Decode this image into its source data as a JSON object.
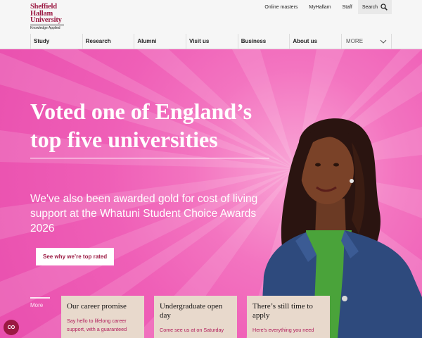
{
  "brand": {
    "line1": "Sheffield",
    "line2": "Hallam",
    "line3": "University",
    "tagline": "Knowledge Applied",
    "color": "#9b1942"
  },
  "utility": {
    "links": [
      "Online masters",
      "MyHallam",
      "Staff"
    ],
    "search_label": "Search"
  },
  "nav": {
    "items": [
      "Study",
      "Research",
      "Alumni",
      "Visit us",
      "Business",
      "About us"
    ],
    "more_label": "MORE"
  },
  "hero": {
    "headline": "Voted one of England’s top five universities",
    "subline": "We've also been awarded gold for cost of living support at the Whatuni Student Choice Awards 2026",
    "cta_label": "See why we’re top rated",
    "more_label": "More",
    "accent": "#ef5fb7"
  },
  "cards": [
    {
      "title": "Our career promise",
      "text": "Say hello to lifelong career support, with a guaranteed"
    },
    {
      "title": "Undergraduate open day",
      "text": "Come see us at on Saturday"
    },
    {
      "title": "There’s still time to apply",
      "text": "Here's everything you need"
    }
  ],
  "cookie_badge": "CO"
}
